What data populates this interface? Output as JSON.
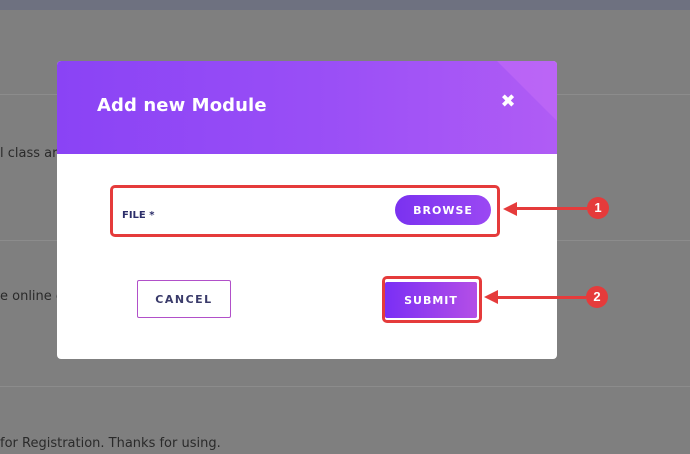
{
  "background": {
    "text_1": "l class ar",
    "text_2": "e online e",
    "text_3": "for Registration. Thanks for using."
  },
  "modal": {
    "title": "Add new Module",
    "close_icon": "✖",
    "file_label": "FILE *",
    "browse_label": "BROWSE",
    "cancel_label": "CANCEL",
    "submit_label": "SUBMIT"
  },
  "annotations": {
    "badge_1": "1",
    "badge_2": "2"
  },
  "colors": {
    "accent": "#8a43f5",
    "annotation": "#e53b3b",
    "overlay": "#7f7f7f"
  }
}
